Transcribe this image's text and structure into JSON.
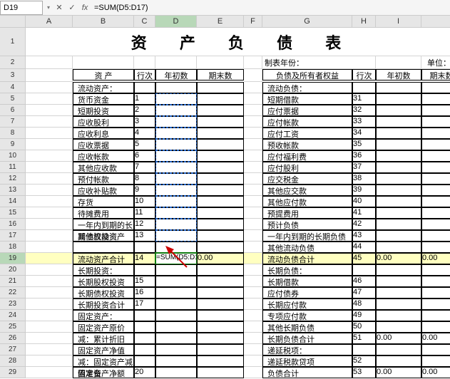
{
  "formula_bar": {
    "cell_ref": "D19",
    "formula": "=SUM(D5:D17)",
    "fx_label": "fx",
    "cancel_icon": "✕",
    "confirm_icon": "✓"
  },
  "columns": [
    "A",
    "B",
    "C",
    "D",
    "E",
    "F",
    "G",
    "H",
    "I"
  ],
  "title": "资 产 负 债 表",
  "meta": {
    "period_label": "制表年份：",
    "unit_label": "单位：元"
  },
  "hdr": {
    "asset": "资  产",
    "seq": "行次",
    "begin": "年初数",
    "end": "期末数",
    "liab": "负债及所有者权益"
  },
  "rows": [
    {
      "r": 4,
      "a": "流动资产：",
      "l": "流动负债："
    },
    {
      "r": 5,
      "a": "货币资金",
      "an": "1",
      "l": "短期借款",
      "ln": "31"
    },
    {
      "r": 6,
      "a": "短期投资",
      "an": "2",
      "l": "应付票据",
      "ln": "32"
    },
    {
      "r": 7,
      "a": "应收股利",
      "an": "3",
      "l": "应付帐款",
      "ln": "33"
    },
    {
      "r": 8,
      "a": "应收利息",
      "an": "4",
      "l": "应付工资",
      "ln": "34"
    },
    {
      "r": 9,
      "a": "应收票据",
      "an": "5",
      "l": "预收帐款",
      "ln": "35"
    },
    {
      "r": 10,
      "a": "应收帐款",
      "an": "6",
      "l": "应付福利费",
      "ln": "36"
    },
    {
      "r": 11,
      "a": "其他应收款",
      "an": "7",
      "l": "应付股利",
      "ln": "37"
    },
    {
      "r": 12,
      "a": "预付帐款",
      "an": "8",
      "l": "应交税金",
      "ln": "38"
    },
    {
      "r": 13,
      "a": "应收补贴款",
      "an": "9",
      "l": "其他应交款",
      "ln": "39"
    },
    {
      "r": 14,
      "a": "存货",
      "an": "10",
      "l": "其他应付款",
      "ln": "40"
    },
    {
      "r": 15,
      "a": "待摊费用",
      "an": "11",
      "l": "预提费用",
      "ln": "41"
    },
    {
      "r": 16,
      "a": "一年内到期的长期债权投资",
      "an": "12",
      "l": "预计负债",
      "ln": "42"
    },
    {
      "r": 17,
      "a": "其他流动资产",
      "an": "13",
      "l": "一年内到期的长期负债",
      "ln": "43"
    },
    {
      "r": 18,
      "a": "",
      "l": "其他流动负债",
      "ln": "44"
    },
    {
      "r": 19,
      "a": "流动资产合计",
      "an": "14",
      "ae": "0.00",
      "l": "流动负债合计",
      "ln": "45",
      "lb": "0.00",
      "le": "0.00",
      "sel": true,
      "formula": "=SUM(D5:D17)"
    },
    {
      "r": 20,
      "a": "长期投资：",
      "l": "长期负债："
    },
    {
      "r": 21,
      "a": "长期股权投资",
      "an": "15",
      "l": "长期借款",
      "ln": "46"
    },
    {
      "r": 22,
      "a": "长期债权投资",
      "an": "16",
      "l": "应付债券",
      "ln": "47"
    },
    {
      "r": 23,
      "a": "长期投资合计",
      "an": "17",
      "l": "长期应付款",
      "ln": "48"
    },
    {
      "r": 24,
      "a": "固定资产：",
      "l": "专项应付款",
      "ln": "49"
    },
    {
      "r": 25,
      "a": "固定资产原价",
      "l": "其他长期负债",
      "ln": "50"
    },
    {
      "r": 26,
      "a": "减：累计折旧",
      "l": "长期负债合计",
      "ln": "51",
      "lb": "0.00",
      "le": "0.00"
    },
    {
      "r": 27,
      "a": "固定资产净值",
      "l": "递延税项：",
      "ln": ""
    },
    {
      "r": 28,
      "a": "减：固定资产减值准备",
      "l": "递延税款贷项",
      "ln": "52"
    },
    {
      "r": 29,
      "a": "固定资产净额",
      "an": "20",
      "l": "负债合计",
      "ln": "53",
      "lb": "0.00",
      "le": "0.00"
    }
  ]
}
